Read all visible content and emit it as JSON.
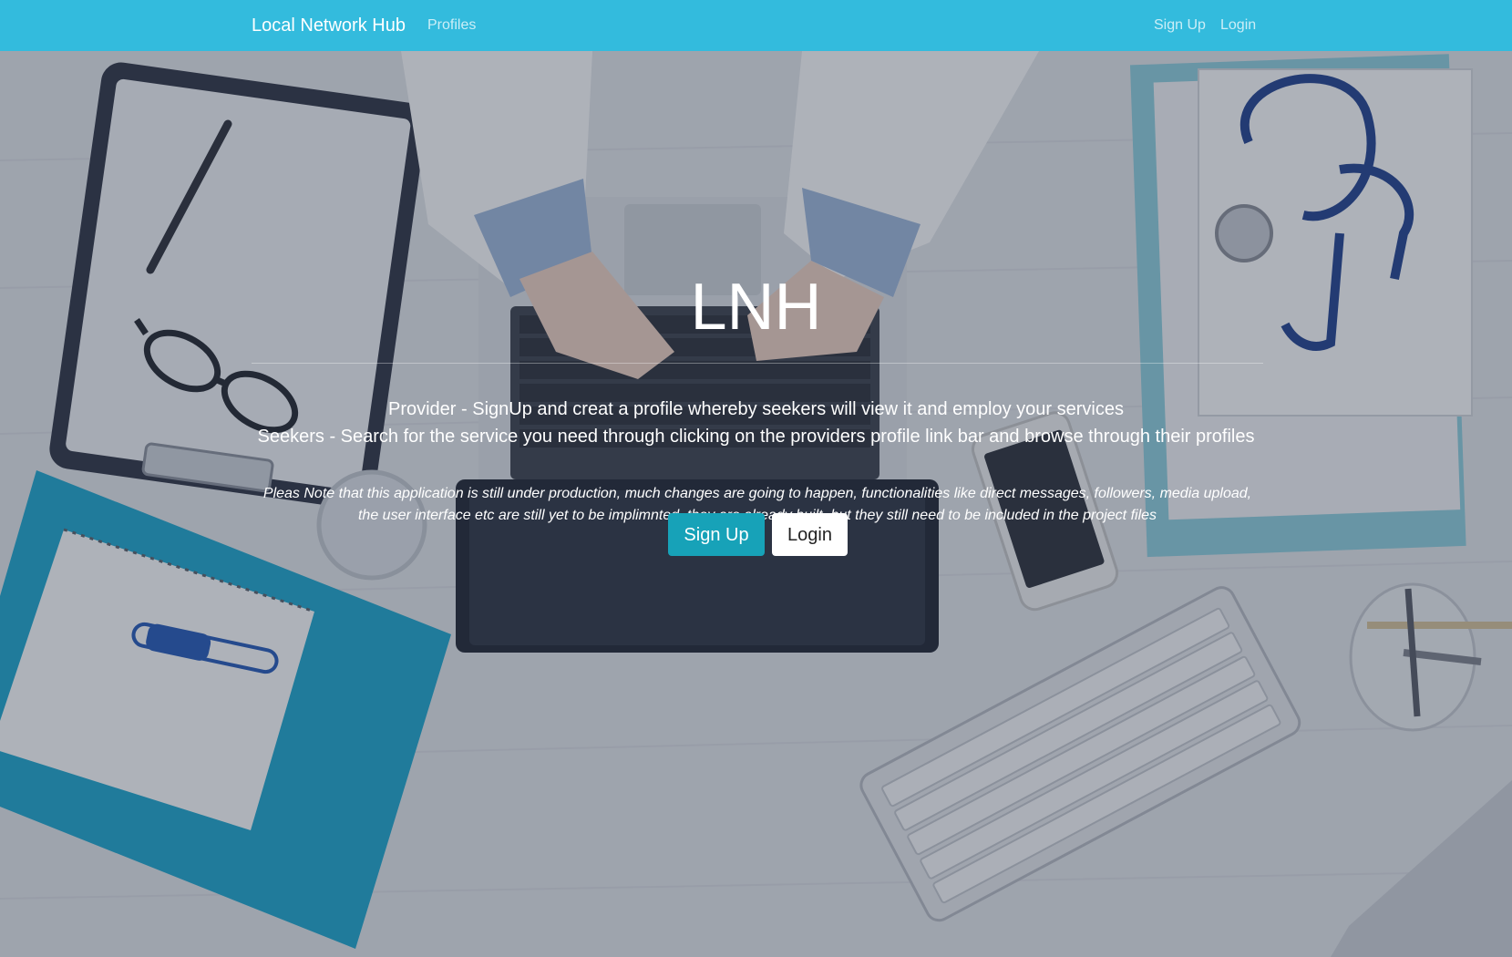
{
  "navbar": {
    "brand": "Local Network Hub",
    "links": {
      "profiles": "Profiles",
      "signup": "Sign Up",
      "login": "Login"
    },
    "color": "#33bbdd"
  },
  "hero": {
    "title": "LNH",
    "provider_text": "Provider - SignUp and creat a profile whereby seekers will view it and employ your services",
    "seekers_text": "Seekers - Search for the service you need through clicking on the providers profile link bar and browse through their profiles",
    "note": "Pleas Note that this application is still under production, much changes are going to happen, functionalities like direct messages, followers, media upload, the user interface etc are still yet to be implimnted, they are already built, but they still need to be included in the project files",
    "buttons": {
      "signup": "Sign Up",
      "login": "Login"
    },
    "background_description_icons": [
      "clipboard-icon",
      "pen-icon",
      "glasses-icon",
      "laptop-icon",
      "stethoscope-icon",
      "phone-icon",
      "keyboard-icon",
      "notepad-icon",
      "thermometer-icon",
      "glass-icon",
      "pen-cup-icon"
    ]
  },
  "colors": {
    "accent": "#17a2b8",
    "navbar": "#33bbdd",
    "overlay": "#2a3448"
  }
}
